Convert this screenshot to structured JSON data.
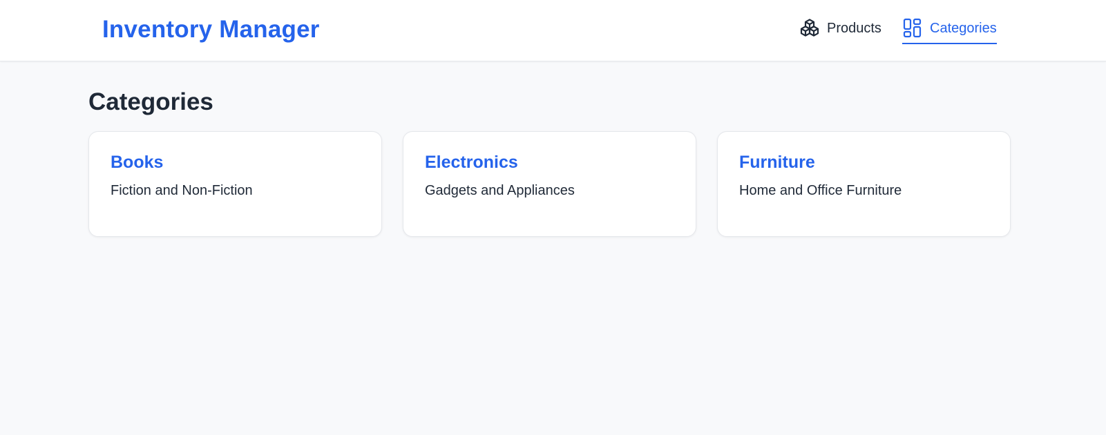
{
  "header": {
    "brand": "Inventory Manager",
    "nav": [
      {
        "label": "Products",
        "icon": "cubes-icon",
        "active": false
      },
      {
        "label": "Categories",
        "icon": "grid-icon",
        "active": true
      }
    ]
  },
  "page": {
    "title": "Categories"
  },
  "categories": [
    {
      "name": "Books",
      "description": "Fiction and Non-Fiction"
    },
    {
      "name": "Electronics",
      "description": "Gadgets and Appliances"
    },
    {
      "name": "Furniture",
      "description": "Home and Office Furniture"
    }
  ],
  "colors": {
    "accent": "#2563eb",
    "text": "#1f2937",
    "background": "#f8f9fb",
    "card": "#ffffff"
  }
}
